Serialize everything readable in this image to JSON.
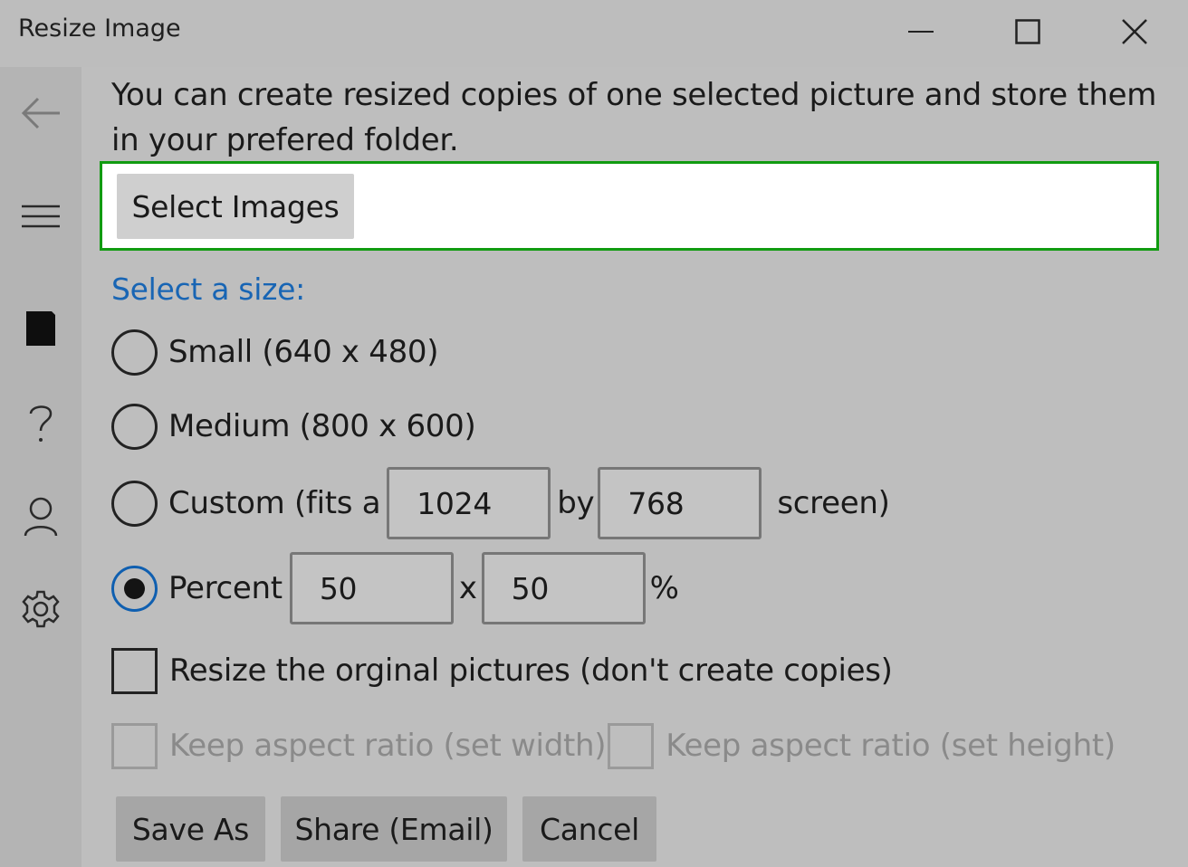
{
  "window": {
    "title": "Resize Image",
    "controls": [
      "minimize-icon",
      "maximize-icon",
      "close-icon"
    ]
  },
  "nav": {
    "items": [
      "back-arrow-icon",
      "hamburger-menu-icon",
      "document-icon",
      "help-icon",
      "person-icon",
      "gear-icon"
    ]
  },
  "main": {
    "intro": "You can create resized copies of one selected picture and store them in your prefered folder.",
    "select_images_label": "Select Images",
    "size_label": "Select a size:",
    "options": {
      "small": "Small (640 x 480)",
      "medium": "Medium (800 x 600)",
      "custom_prefix": "Custom (fits a",
      "custom_width": "1024",
      "custom_by": "by",
      "custom_height": "768",
      "custom_suffix": "screen)",
      "percent_label": "Percent",
      "percent_width": "50",
      "percent_x": "x",
      "percent_height": "50",
      "percent_suffix": "%"
    },
    "selected_option": "percent",
    "resize_original_label": "Resize the orginal pictures (don't create copies)",
    "resize_original_checked": false,
    "keep_aspect_width_label": "Keep aspect ratio (set width)",
    "keep_aspect_height_label": "Keep aspect ratio (set height)",
    "keep_aspect_disabled": true,
    "buttons": {
      "save_as": "Save As",
      "share_email": "Share (Email)",
      "cancel": "Cancel"
    }
  },
  "colors": {
    "accent_blue": "#1865b4",
    "focus_green": "#119b11",
    "background": "#bebebe"
  }
}
